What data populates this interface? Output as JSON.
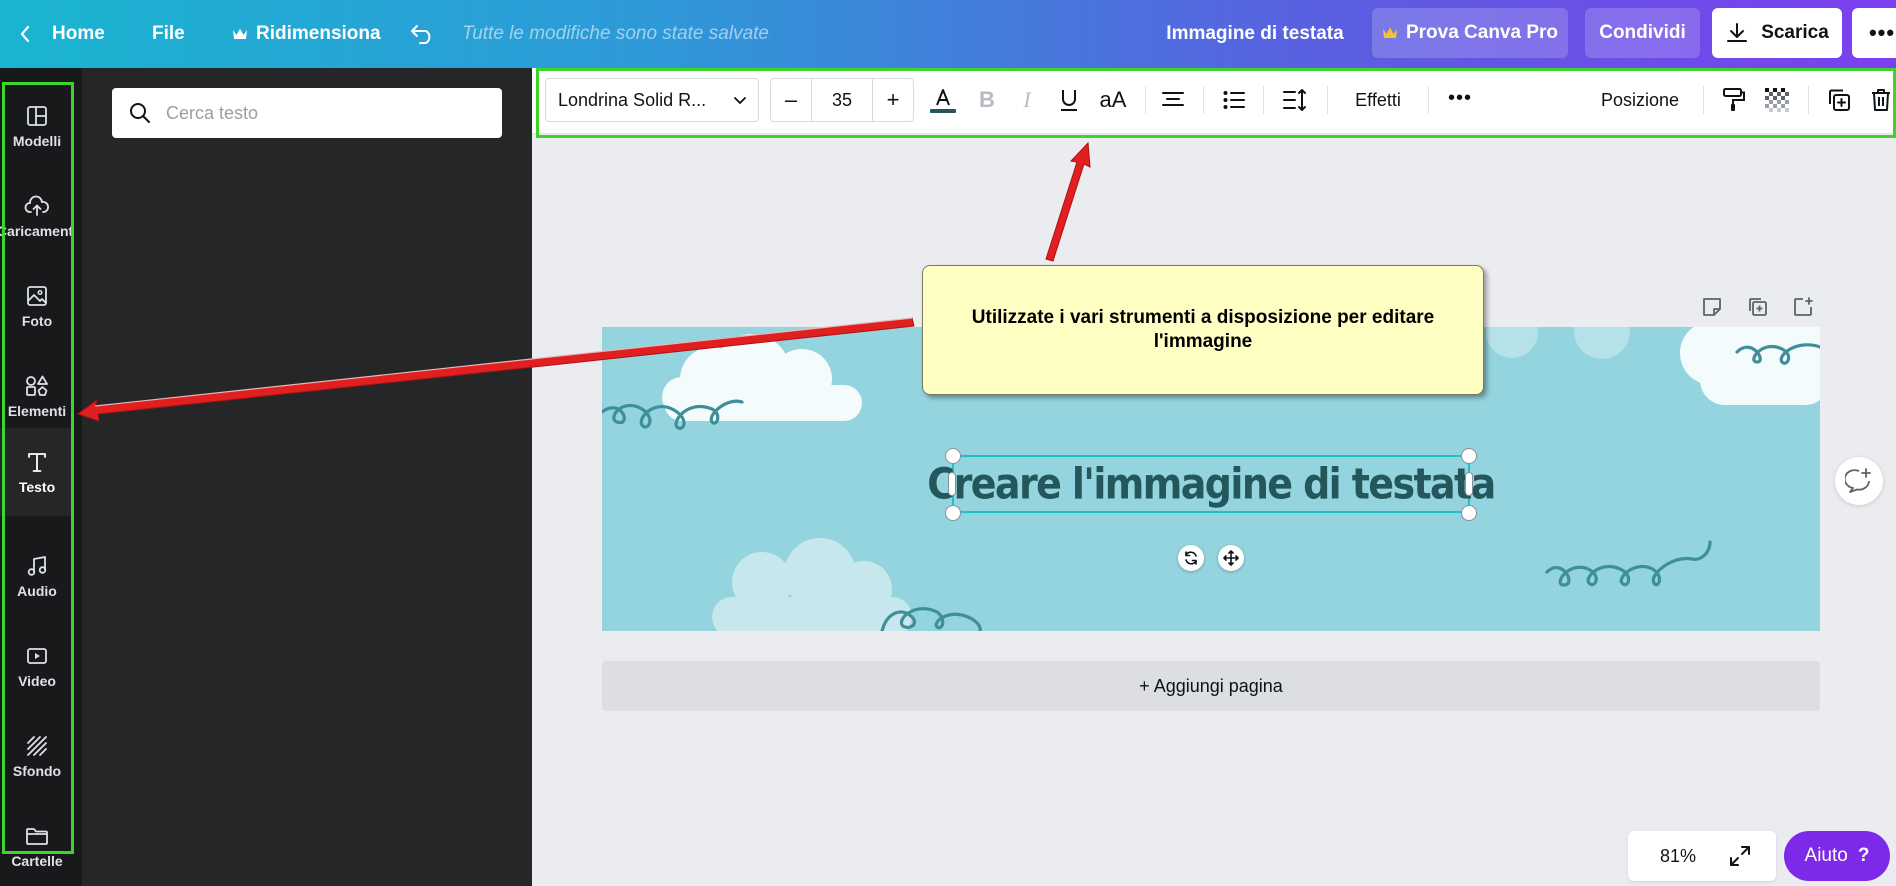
{
  "topbar": {
    "home": "Home",
    "file": "File",
    "resize": "Ridimensiona",
    "saved_status": "Tutte le modifiche sono state salvate",
    "doc_title": "Immagine di testata",
    "try_pro": "Prova Canva Pro",
    "share": "Condividi",
    "download": "Scarica",
    "more": "•••"
  },
  "rail": {
    "items": [
      {
        "label": "Modelli",
        "icon": "templates-icon"
      },
      {
        "label": "Caricamenti",
        "icon": "upload-cloud-icon"
      },
      {
        "label": "Foto",
        "icon": "photo-icon"
      },
      {
        "label": "Elementi",
        "icon": "elements-icon"
      },
      {
        "label": "Testo",
        "icon": "text-icon"
      },
      {
        "label": "Audio",
        "icon": "music-note-icon"
      },
      {
        "label": "Video",
        "icon": "video-icon"
      },
      {
        "label": "Sfondo",
        "icon": "background-icon"
      },
      {
        "label": "Cartelle",
        "icon": "folder-icon"
      }
    ]
  },
  "panel": {
    "search_placeholder": "Cerca testo"
  },
  "toolbar": {
    "font": "Londrina Solid R...",
    "decrease": "–",
    "font_size": "35",
    "increase": "+",
    "case": "aA",
    "effects": "Effetti",
    "more": "•••",
    "position": "Posizione"
  },
  "canvas": {
    "headline": "Creare l'immagine di testata",
    "add_page": "+ Aggiungi pagina"
  },
  "footer": {
    "zoom": "81%",
    "help": "Aiuto",
    "help_icon": "?"
  },
  "annotation": {
    "text": "Utilizzate i vari strumenti a disposizione per editare l'immagine"
  },
  "colors": {
    "highlight": "#3ed42d",
    "arrow": "#e02020",
    "canvas_bg": "#93d4de",
    "headline": "#24565c",
    "brand_purple": "#7d2ae8"
  }
}
